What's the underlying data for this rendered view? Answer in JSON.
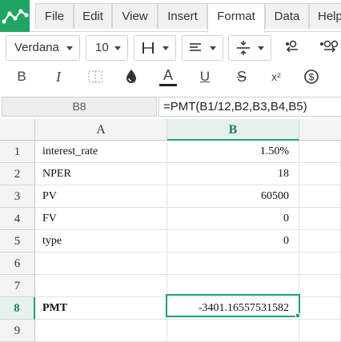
{
  "menu": {
    "tabs": [
      {
        "label": "File"
      },
      {
        "label": "Edit"
      },
      {
        "label": "View"
      },
      {
        "label": "Insert"
      },
      {
        "label": "Format"
      },
      {
        "label": "Data"
      },
      {
        "label": "Help"
      }
    ],
    "active_tab": "Format"
  },
  "toolbar": {
    "font_family": "Verdana",
    "font_size": "10",
    "icons": [
      "borders-icon",
      "align-icon",
      "valign-icon",
      "decrease-decimal-icon",
      "increase-decimal-icon",
      "bold-icon",
      "italic-icon",
      "merge-cells-icon",
      "fill-color-icon",
      "text-color-icon",
      "underline-icon",
      "strikethrough-icon",
      "superscript-icon",
      "currency-icon"
    ],
    "bold_label": "B",
    "italic_label": "I",
    "text_color_label": "A",
    "underline_label": "U",
    "strike_label": "S",
    "superscript_label": "x²"
  },
  "formula_bar": {
    "cell_ref": "B8",
    "formula": "=PMT(B1/12,B2,B3,B4,B5)"
  },
  "sheet": {
    "columns": [
      "A",
      "B"
    ],
    "selected_column": "B",
    "selected_row": "8",
    "rows": [
      {
        "num": "1",
        "a": "interest_rate",
        "b": "1.50%"
      },
      {
        "num": "2",
        "a": "NPER",
        "b": "18"
      },
      {
        "num": "3",
        "a": "PV",
        "b": "60500"
      },
      {
        "num": "4",
        "a": "FV",
        "b": "0"
      },
      {
        "num": "5",
        "a": "type",
        "b": "0"
      },
      {
        "num": "6",
        "a": "",
        "b": ""
      },
      {
        "num": "7",
        "a": "",
        "b": ""
      },
      {
        "num": "8",
        "a": "PMT",
        "b": "-3401.16557531582"
      },
      {
        "num": "9",
        "a": "",
        "b": ""
      }
    ]
  },
  "colors": {
    "brand": "#1fa463",
    "selection": "#21a366"
  }
}
